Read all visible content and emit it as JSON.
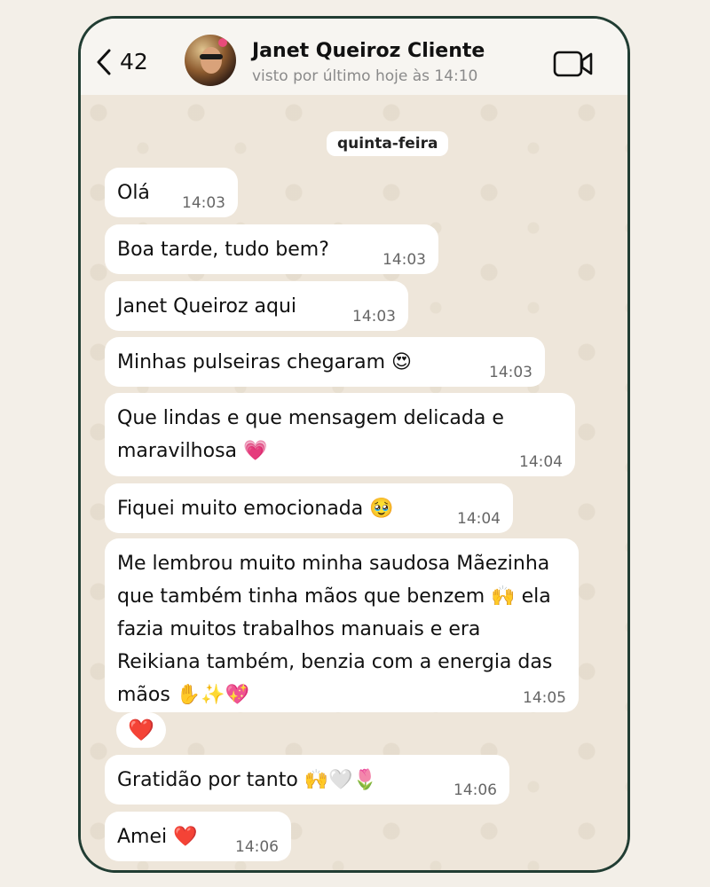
{
  "header": {
    "back_count": "42",
    "contact_name": "Janet Queiroz Cliente",
    "last_seen": "visto por último hoje às 14:10"
  },
  "date_chip": "quinta-feira",
  "messages": [
    {
      "text": "Olá",
      "time": "14:03"
    },
    {
      "text": "Boa tarde, tudo bem?",
      "time": "14:03"
    },
    {
      "text": "Janet Queiroz aqui",
      "time": "14:03"
    },
    {
      "text": "Minhas pulseiras chegaram 😍",
      "time": "14:03"
    },
    {
      "text": "Que lindas e que mensagem delicada e maravilhosa 💗",
      "time": "14:04"
    },
    {
      "text": "Fiquei muito emocionada 🥹",
      "time": "14:04"
    },
    {
      "text": "Me lembrou muito minha saudosa Mãezinha que também tinha mãos que benzem 🙌 ela fazia muitos trabalhos manuais e era Reikiana também, benzia com a energia das mãos ✋✨💖",
      "time": "14:05"
    },
    {
      "text": "Gratidão por tanto 🙌🤍🌷",
      "time": "14:06"
    },
    {
      "text": "Amei ❤️",
      "time": "14:06"
    }
  ],
  "reaction": "❤️",
  "colors": {
    "frame": "#213d33",
    "background": "#f3efe8",
    "bubble": "#ffffff",
    "wallpaper": "#eee6da"
  }
}
